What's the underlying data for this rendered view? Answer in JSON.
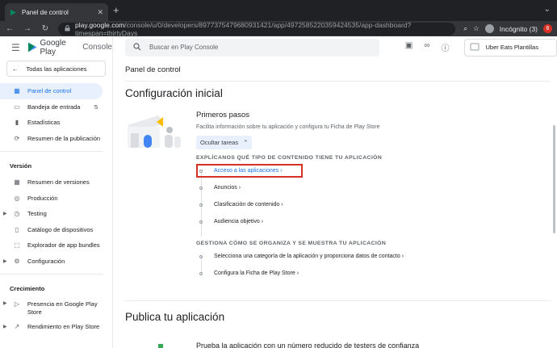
{
  "browser": {
    "tab_title": "Panel de control",
    "url_host": "play.google.com",
    "url_path": "/console/u/0/developers/8977375479680931421/app/4972585220359424535/app-dashboard?timespan=thirtyDays",
    "profile_label": "Incógnito (3)",
    "notif_count": "6"
  },
  "sidebar": {
    "logo_text_1": "Google Play",
    "logo_text_2": "Console",
    "all_apps": "Todas las aplicaciones",
    "items": [
      {
        "label": "Panel de control",
        "icon": "dashboard-icon"
      },
      {
        "label": "Bandeja de entrada",
        "count": "5",
        "icon": "inbox-icon"
      },
      {
        "label": "Estadísticas",
        "icon": "stats-icon"
      },
      {
        "label": "Resumen de la publicación",
        "icon": "publish-icon"
      }
    ],
    "section_version": "Versión",
    "version_items": [
      {
        "label": "Resumen de versiones"
      },
      {
        "label": "Producción"
      },
      {
        "label": "Testing"
      },
      {
        "label": "Catálogo de dispositivos"
      },
      {
        "label": "Explorador de app bundles"
      },
      {
        "label": "Configuración"
      }
    ],
    "section_growth": "Crecimiento",
    "growth_items": [
      {
        "label": "Presencia en Google Play Store"
      },
      {
        "label": "Rendimiento en Play Store"
      }
    ]
  },
  "header": {
    "search_placeholder": "Buscar en Play Console",
    "app_name": "Uber Eats Plantillas"
  },
  "main": {
    "page_title": "Panel de control",
    "section_title": "Configuración inicial",
    "card_title": "Primeros pasos",
    "card_desc": "Facilita información sobre tu aplicación y configura tu Ficha de Play Store",
    "hide_tasks": "Ocultar tareas",
    "group1_title": "EXPLÍCANOS QUÉ TIPO DE CONTENIDO TIENE TU APLICACIÓN",
    "group1_tasks": [
      "Acceso a las aplicaciones ›",
      "Anuncios ›",
      "Clasificación de contenido ›",
      "Audiencia objetivo ›"
    ],
    "group2_title": "GESTIONA CÓMO SE ORGANIZA Y SE MUESTRA TU APLICACIÓN",
    "group2_tasks": [
      "Selecciona una categoría de la aplicación y proporciona datos de contacto ›",
      "Configura la Ficha de Play Store ›"
    ],
    "publish_title": "Publica tu aplicación",
    "publish_sub": "Prueba la aplicación con un número reducido de testers de confianza"
  },
  "colors": {
    "accent": "#1a73e8",
    "highlight": "#d93025"
  }
}
